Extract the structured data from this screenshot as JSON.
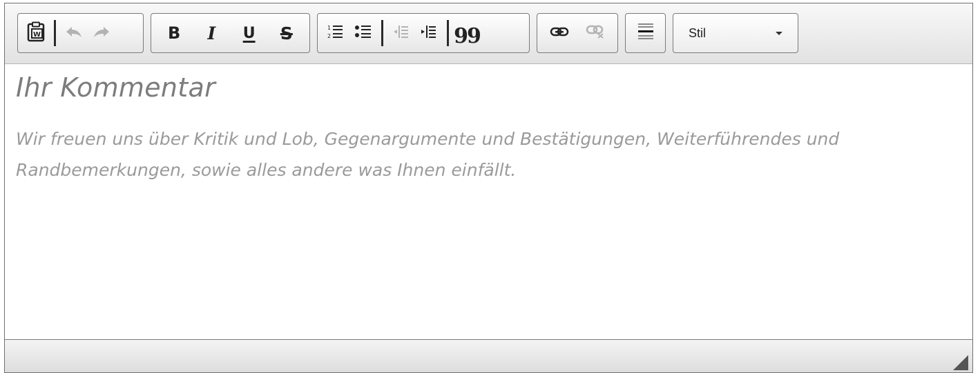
{
  "toolbar": {
    "style_select": {
      "label": "Stil"
    },
    "buttons": [
      {
        "name": "paste-from-word-button",
        "icon": "paste-word-icon"
      },
      {
        "name": "undo-button",
        "icon": "undo-icon",
        "enabled": false
      },
      {
        "name": "redo-button",
        "icon": "redo-icon",
        "enabled": false
      },
      {
        "name": "bold-button",
        "label": "B"
      },
      {
        "name": "italic-button",
        "label": "I"
      },
      {
        "name": "underline-button",
        "label": "U"
      },
      {
        "name": "strikethrough-button",
        "label": "S"
      },
      {
        "name": "numbered-list-button",
        "icon": "numbered-list-icon"
      },
      {
        "name": "bulleted-list-button",
        "icon": "bulleted-list-icon"
      },
      {
        "name": "decrease-indent-button",
        "icon": "outdent-icon",
        "enabled": false
      },
      {
        "name": "increase-indent-button",
        "icon": "indent-icon"
      },
      {
        "name": "blockquote-button",
        "label": "99"
      },
      {
        "name": "link-button",
        "icon": "link-icon"
      },
      {
        "name": "unlink-button",
        "icon": "unlink-icon",
        "enabled": false
      },
      {
        "name": "horizontal-rule-button",
        "icon": "horizontal-rule-icon"
      }
    ]
  },
  "content": {
    "heading": "Ihr Kommentar",
    "placeholder": "Wir freuen uns über Kritik und Lob, Gegenargumente und Bestätigungen, Weiterführendes und Randbemerkungen, sowie alles andere was Ihnen einfällt."
  },
  "colors": {
    "toolbar_bg": "#e9e9e9",
    "border": "#7a7a7a",
    "placeholder_text": "#9a9a9a"
  }
}
